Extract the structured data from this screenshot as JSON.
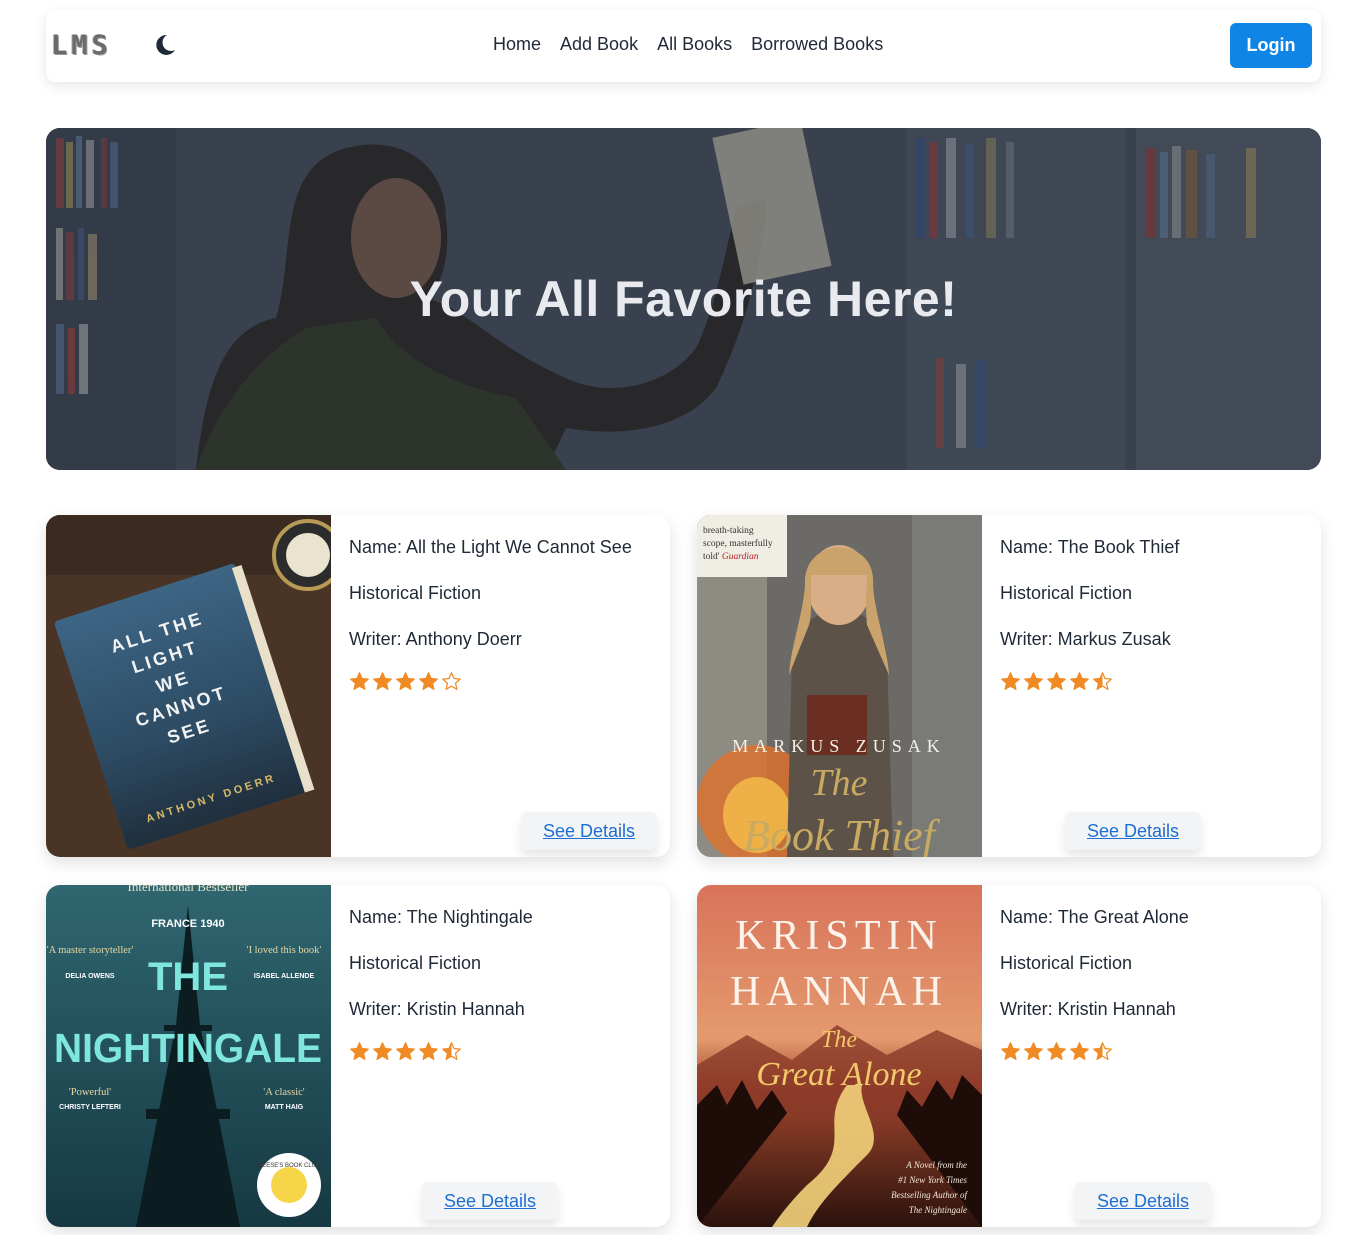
{
  "nav": {
    "logo": "LMS",
    "links": [
      "Home",
      "Add Book",
      "All Books",
      "Borrowed Books"
    ],
    "login_label": "Login"
  },
  "hero": {
    "title": "Your All Favorite Here!"
  },
  "books": [
    {
      "name": "Name: All the Light We Cannot See",
      "category": "Historical Fiction",
      "writer": "Writer: Anthony Doerr",
      "rating": 4,
      "cover_title": "ALL THE LIGHT WE CANNOT SEE",
      "cover_author": "ANTHONY DOERR",
      "details_label": "See Details"
    },
    {
      "name": "Name: The Book Thief",
      "category": "Historical Fiction",
      "writer": "Writer: Markus Zusak",
      "rating": 4.5,
      "cover_author": "MARKUS ZUSAK",
      "cover_title_line1": "The",
      "cover_title_line2": "Book Thief",
      "cover_quote": "breath-taking scope, masterfully told' Guardian",
      "details_label": "See Details"
    },
    {
      "name": "Name: The Nightingale",
      "category": "Historical Fiction",
      "writer": "Writer: Kristin Hannah",
      "rating": 4.5,
      "cover_top": "International Bestseller",
      "cover_subtitle": "FRANCE 1940",
      "cover_title_line1": "THE",
      "cover_title_line2": "NIGHTINGALE",
      "cover_quotes": [
        "'A master storyteller'",
        "'I loved this book'",
        "'Powerful'",
        "'A classic'"
      ],
      "cover_quote_authors": [
        "DELIA OWENS",
        "ISABEL ALLENDE",
        "CHRISTY LEFTERI",
        "MATT HAIG"
      ],
      "cover_badge": "REESE'S BOOK CLUB",
      "details_label": "See Details"
    },
    {
      "name": "Name: The Great Alone",
      "category": "Historical Fiction",
      "writer": "Writer: Kristin Hannah",
      "rating": 4.5,
      "cover_author_line1": "KRISTIN",
      "cover_author_line2": "HANNAH",
      "cover_title_line1": "The",
      "cover_title_line2": "Great Alone",
      "cover_tagline": "A Novel from the #1 New York Times Bestselling Author of The Nightingale",
      "details_label": "See Details"
    }
  ],
  "colors": {
    "primary": "#0f86e5",
    "link": "#1d6fd1",
    "star": "#f08a24"
  }
}
